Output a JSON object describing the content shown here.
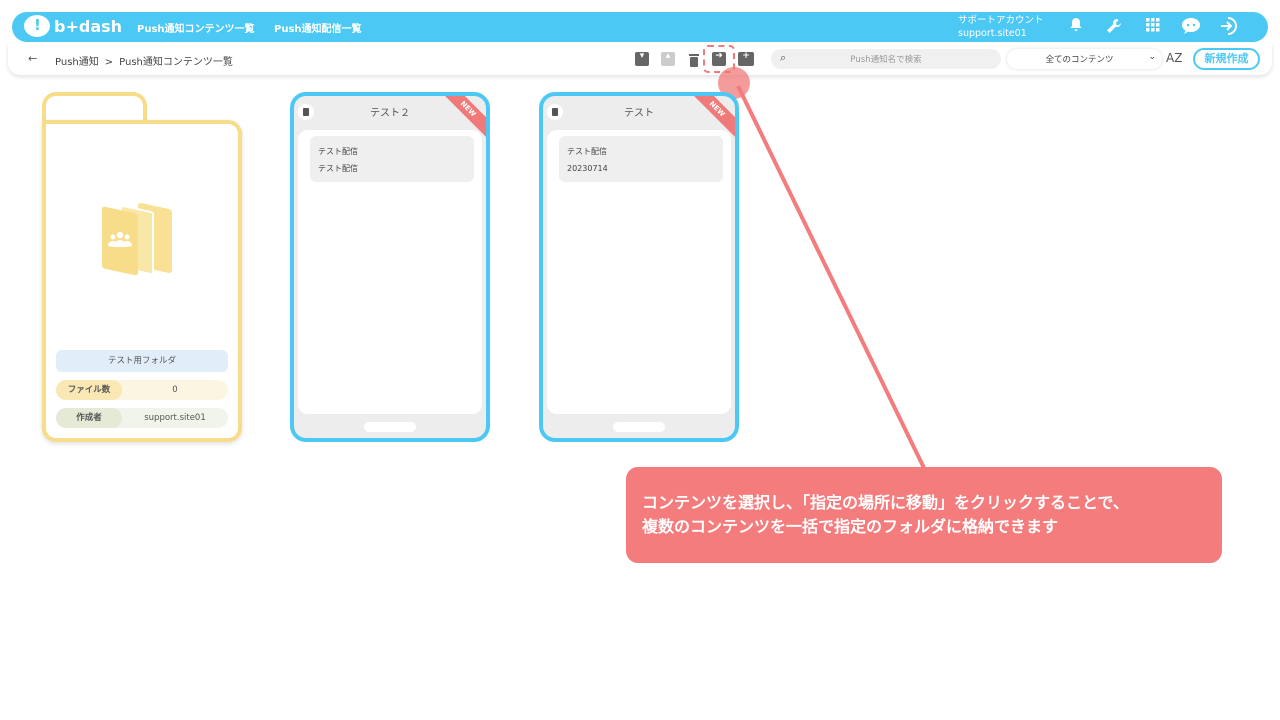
{
  "header": {
    "logo_text": "b+dash",
    "nav": [
      "Push通知コンテンツ一覧",
      "Push通知配信一覧"
    ],
    "account_label": "サポートアカウント",
    "account_id": "support.site01"
  },
  "subbar": {
    "breadcrumb": [
      "Push通知",
      "Push通知コンテンツ一覧"
    ],
    "breadcrumb_sep": ">",
    "search_placeholder": "Push通知名で検索",
    "filter_value": "全てのコンテンツ",
    "sort_label": "AZ",
    "new_button": "新規作成"
  },
  "folder": {
    "name": "テスト用フォルダ",
    "file_count_label": "ファイル数",
    "file_count": "0",
    "author_label": "作成者",
    "author": "support.site01"
  },
  "cards": [
    {
      "title": "テスト２",
      "badge": "NEW",
      "line1": "テスト配信",
      "line2": "テスト配信"
    },
    {
      "title": "テスト",
      "badge": "NEW",
      "line1": "テスト配信",
      "line2": "20230714"
    }
  ],
  "annotation": {
    "line1": "コンテンツを選択し、「指定の場所に移動」をクリックすることで、",
    "line2": "複数のコンテンツを一括で指定のフォルダに格納できます"
  },
  "colors": {
    "accent": "#4cc8f4",
    "folder": "#f7dd8a",
    "annotation": "#f47c7d"
  }
}
